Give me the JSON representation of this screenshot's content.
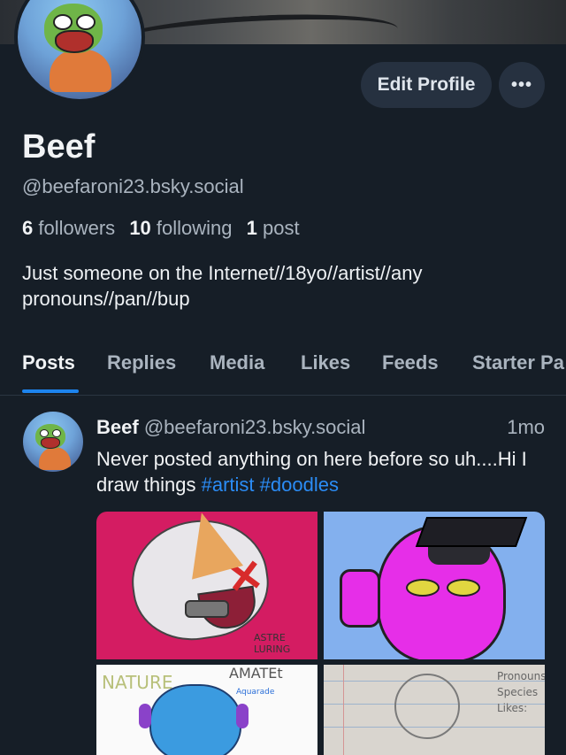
{
  "profile": {
    "display_name": "Beef",
    "handle": "@beefaroni23.bsky.social",
    "followers_count": "6",
    "followers_label": "followers",
    "following_count": "10",
    "following_label": "following",
    "posts_count": "1",
    "posts_label": "post",
    "bio": "Just someone on the Internet//18yo//artist//any pronouns//pan//bup"
  },
  "actions": {
    "edit_profile_label": "Edit Profile",
    "more_label": "•••"
  },
  "tabs": [
    {
      "label": "Posts",
      "active": true
    },
    {
      "label": "Replies",
      "active": false
    },
    {
      "label": "Media",
      "active": false
    },
    {
      "label": "Likes",
      "active": false
    },
    {
      "label": "Feeds",
      "active": false
    },
    {
      "label": "Starter Pa",
      "active": false
    }
  ],
  "post": {
    "author_name": "Beef",
    "author_handle": "@beefaroni23.bsky.social",
    "time": "1mo",
    "text_before": "Never posted anything on here before so uh....Hi I draw things ",
    "hashtags": [
      "#artist",
      "#doodles"
    ],
    "images": [
      {
        "alt": "red and white cat drawing",
        "signature": "ASTRE LURING"
      },
      {
        "alt": "pink character with graduation cap"
      },
      {
        "alt": "blue character drawing",
        "labels": [
          "NATURE",
          "AMATEt",
          "Aquarade"
        ]
      },
      {
        "alt": "pencil sketch",
        "labels": [
          "Pronouns",
          "Species",
          "Likes:"
        ]
      }
    ]
  },
  "colors": {
    "background": "#161e27",
    "accent": "#1d84ee",
    "hashtag": "#2b8cf5",
    "button_bg": "#263140",
    "muted_text": "#aab4bf"
  }
}
